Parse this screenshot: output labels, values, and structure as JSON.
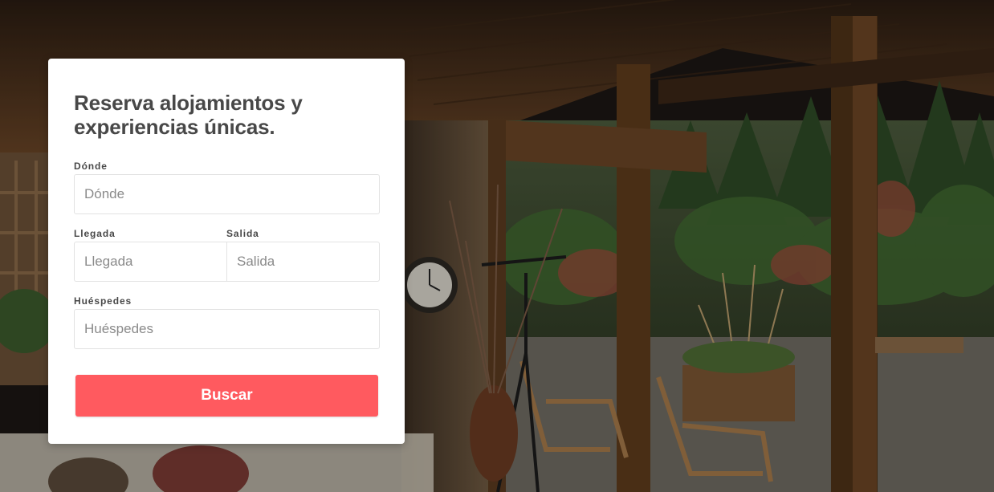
{
  "form": {
    "title": "Reserva alojamientos y experiencias únicas.",
    "where": {
      "label": "Dónde",
      "placeholder": "Dónde",
      "value": ""
    },
    "checkin": {
      "label": "Llegada",
      "placeholder": "Llegada",
      "value": ""
    },
    "checkout": {
      "label": "Salida",
      "placeholder": "Salida",
      "value": ""
    },
    "guests": {
      "label": "Huéspedes",
      "placeholder": "Huéspedes",
      "value": ""
    },
    "submit_label": "Buscar"
  },
  "colors": {
    "accent": "#ff5a5f",
    "text": "#484848",
    "input_border": "#e2e2e2",
    "placeholder": "#8a8a8a"
  }
}
